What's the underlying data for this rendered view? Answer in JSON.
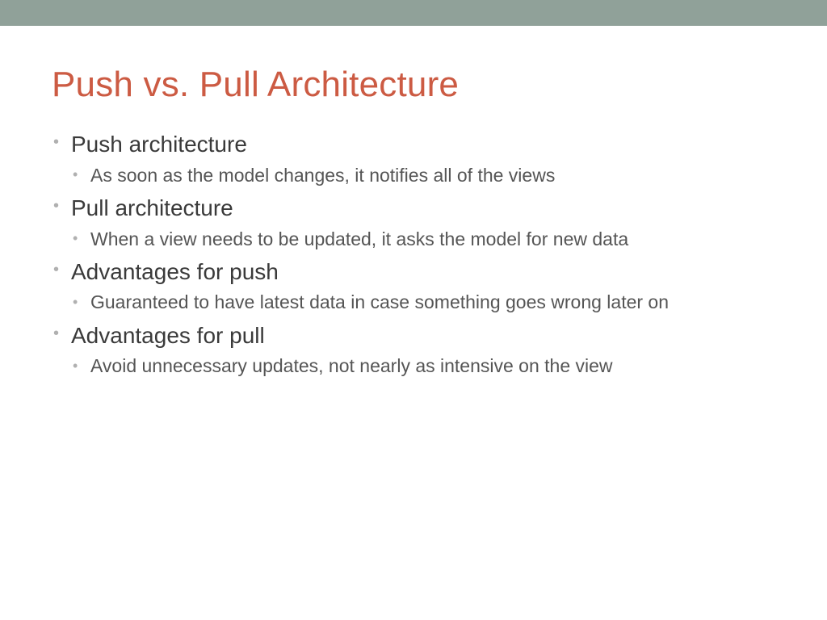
{
  "title": "Push vs. Pull Architecture",
  "bullets": [
    {
      "text": "Push architecture",
      "sub": [
        "As soon as the model changes, it notifies all of the views"
      ]
    },
    {
      "text": "Pull architecture",
      "sub": [
        "When a view needs to be updated, it asks the model for new data"
      ]
    },
    {
      "text": "Advantages for push",
      "sub": [
        "Guaranteed to have latest data in case something goes wrong later on"
      ]
    },
    {
      "text": "Advantages for pull",
      "sub": [
        "Avoid unnecessary updates, not nearly as intensive on the view"
      ]
    }
  ]
}
